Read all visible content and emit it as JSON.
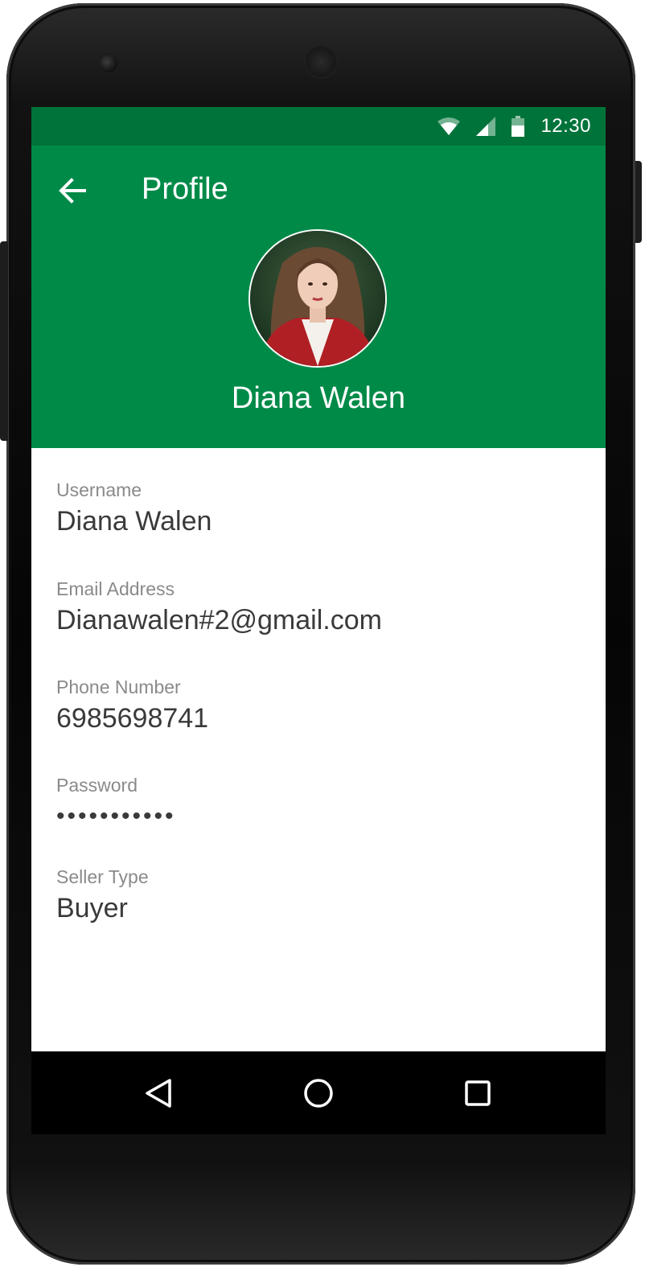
{
  "status_bar": {
    "time": "12:30",
    "icons": [
      "wifi-icon",
      "signal-icon",
      "battery-icon"
    ]
  },
  "header": {
    "title": "Profile",
    "back_icon": "arrow-left-icon",
    "profile_name": "Diana Walen"
  },
  "fields": [
    {
      "label": "Username",
      "value": "Diana Walen"
    },
    {
      "label": "Email Address",
      "value": "Dianawalen#2@gmail.com"
    },
    {
      "label": "Phone Number",
      "value": "6985698741"
    },
    {
      "label": "Password",
      "value": "•••••••••••"
    },
    {
      "label": "Seller Type",
      "value": "Buyer"
    }
  ],
  "nav_bar": {
    "icons": [
      "back-triangle-icon",
      "home-circle-icon",
      "recents-square-icon"
    ]
  },
  "colors": {
    "status_bar": "#00733a",
    "header": "#008a48",
    "label_text": "#8a8a8a",
    "value_text": "#3a3a3a"
  }
}
